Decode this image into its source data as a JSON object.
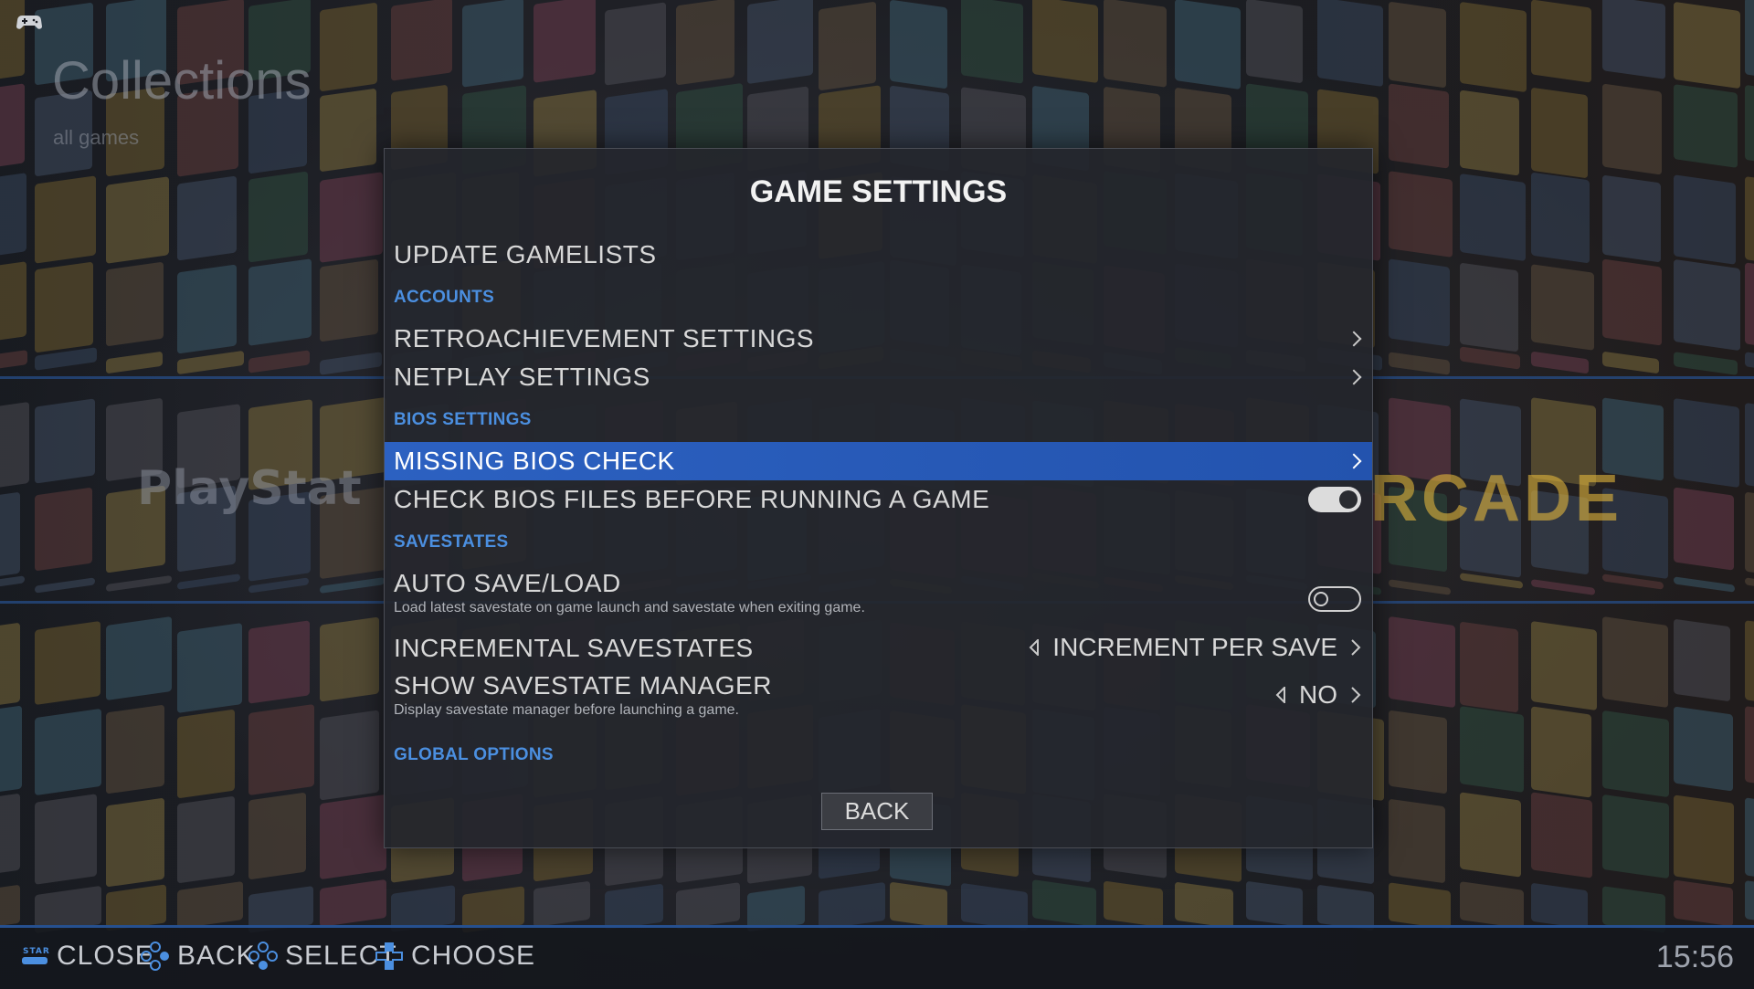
{
  "header": {
    "title": "Collections",
    "subtitle": "all games"
  },
  "background": {
    "left_logo": "PlayStat",
    "right_logo": "RCADE"
  },
  "dialog": {
    "title": "GAME SETTINGS",
    "items": [
      {
        "label": "UPDATE GAMELISTS"
      },
      {
        "section": "ACCOUNTS"
      },
      {
        "label": "RETROACHIEVEMENT SETTINGS",
        "control": "submenu"
      },
      {
        "label": "NETPLAY SETTINGS",
        "control": "submenu"
      },
      {
        "section": "BIOS SETTINGS"
      },
      {
        "label": "MISSING BIOS CHECK",
        "control": "submenu",
        "selected": true
      },
      {
        "label": "CHECK BIOS FILES BEFORE RUNNING A GAME",
        "control": "switch",
        "value": true
      },
      {
        "section": "SAVESTATES"
      },
      {
        "label": "AUTO SAVE/LOAD",
        "description": "Load latest savestate on game launch and savestate when exiting game.",
        "control": "switch",
        "value": false
      },
      {
        "label": "INCREMENTAL SAVESTATES",
        "control": "selector",
        "value": "INCREMENT PER SAVE"
      },
      {
        "label": "SHOW SAVESTATE MANAGER",
        "description": "Display savestate manager before launching a game.",
        "control": "selector",
        "value": "NO"
      },
      {
        "section": "GLOBAL OPTIONS"
      }
    ],
    "back_label": "BACK"
  },
  "help_bar": {
    "items": [
      {
        "icon": "start-button-icon",
        "label": "CLOSE"
      },
      {
        "icon": "dpad-b-icon",
        "label": "BACK"
      },
      {
        "icon": "dpad-a-icon",
        "label": "SELECT"
      },
      {
        "icon": "dpad-updown-icon",
        "label": "CHOOSE"
      }
    ],
    "clock": "15:56"
  },
  "colors": {
    "accent": "#2c61c1",
    "section": "#4b8fe0",
    "dialog_bg": "#24262c"
  }
}
